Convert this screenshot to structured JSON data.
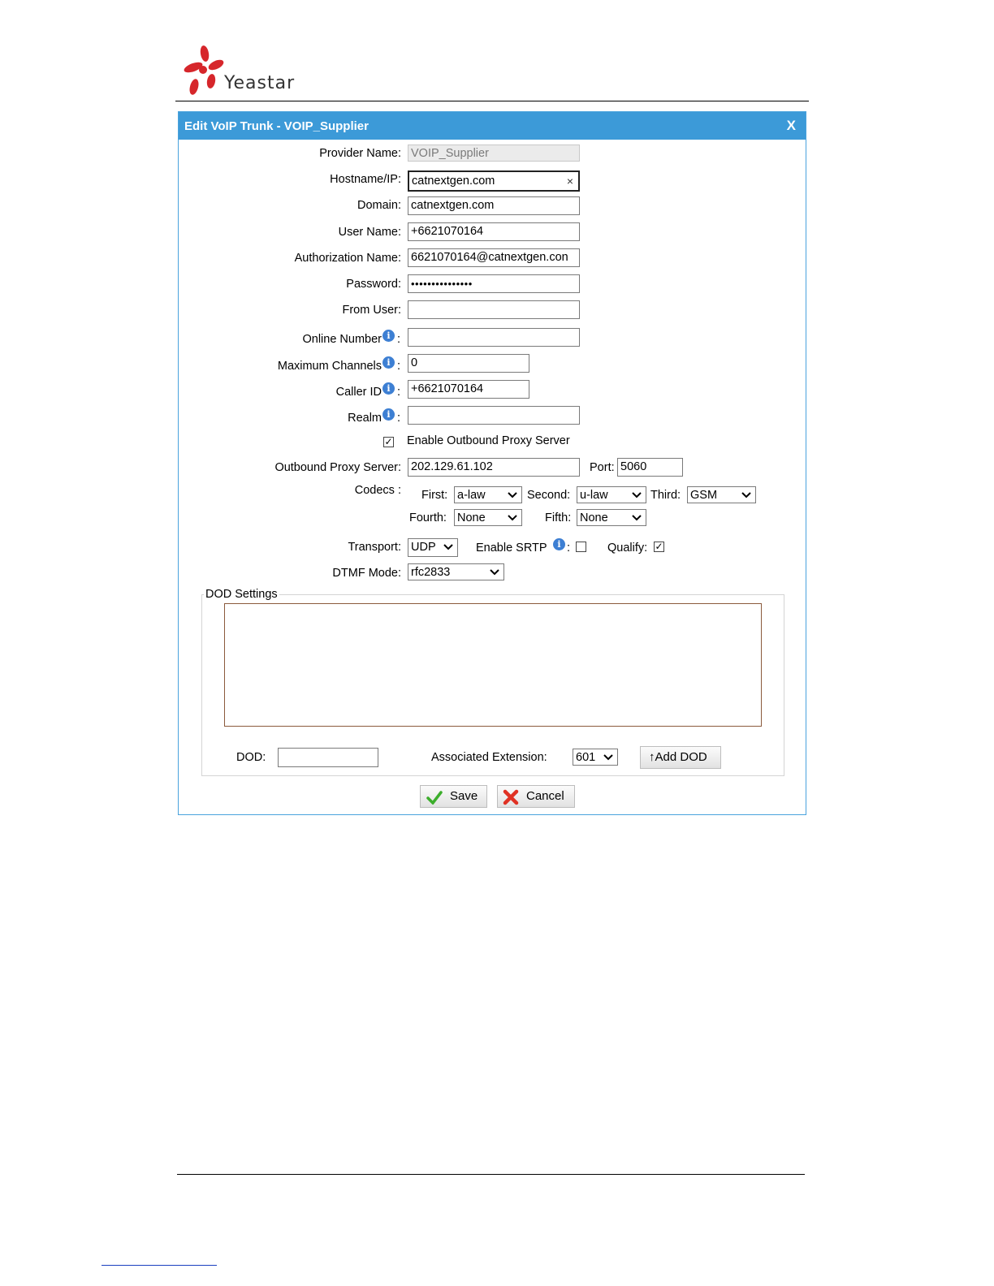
{
  "brand": {
    "name": "Yeastar"
  },
  "dialog": {
    "title": "Edit VoIP Trunk - VOIP_Supplier",
    "close_label": "X"
  },
  "form": {
    "provider_name": {
      "label": "Provider Name:",
      "value": "VOIP_Supplier"
    },
    "hostname": {
      "label": "Hostname/IP:",
      "value": "catnextgen.com",
      "clear": "×"
    },
    "domain": {
      "label": "Domain:",
      "value": "catnextgen.com"
    },
    "user_name": {
      "label": "User Name:",
      "value": "+6621070164"
    },
    "auth_name": {
      "label": "Authorization Name:",
      "value": "6621070164@catnextgen.con"
    },
    "password": {
      "label": "Password:",
      "value": "•••••••••••••••"
    },
    "from_user": {
      "label": "From User:",
      "value": ""
    },
    "online_number": {
      "label": "Online Number",
      "value": ""
    },
    "max_channels": {
      "label": "Maximum Channels",
      "value": "0"
    },
    "caller_id": {
      "label": "Caller ID",
      "value": "+6621070164"
    },
    "realm": {
      "label": "Realm",
      "value": ""
    },
    "colon": ":",
    "enable_proxy": {
      "label": "Enable Outbound Proxy Server",
      "checked": true
    },
    "proxy_server": {
      "label": "Outbound Proxy Server:",
      "value": "202.129.61.102"
    },
    "port": {
      "label": "Port:",
      "value": "5060"
    },
    "codecs": {
      "label": "Codecs :",
      "first": {
        "label": "First:",
        "value": "a-law"
      },
      "second": {
        "label": "Second:",
        "value": "u-law"
      },
      "third": {
        "label": "Third:",
        "value": "GSM"
      },
      "fourth": {
        "label": "Fourth:",
        "value": "None"
      },
      "fifth": {
        "label": "Fifth:",
        "value": "None"
      }
    },
    "transport": {
      "label": "Transport:",
      "value": "UDP"
    },
    "enable_srtp": {
      "label": "Enable SRTP",
      "checked": false
    },
    "qualify": {
      "label": "Qualify:",
      "checked": true
    },
    "dtmf_mode": {
      "label": "DTMF Mode:",
      "value": "rfc2833"
    }
  },
  "dod": {
    "legend": "DOD Settings",
    "dod_label": "DOD:",
    "dod_value": "",
    "ext_label": "Associated Extension:",
    "ext_value": "601",
    "add_button": "↑Add DOD"
  },
  "actions": {
    "save": "Save",
    "cancel": "Cancel"
  },
  "icons": {
    "info": "i",
    "check": "✓",
    "chevron": "❯"
  },
  "colors": {
    "titlebar": "#3c9ad8",
    "brand_red": "#d6262b"
  }
}
